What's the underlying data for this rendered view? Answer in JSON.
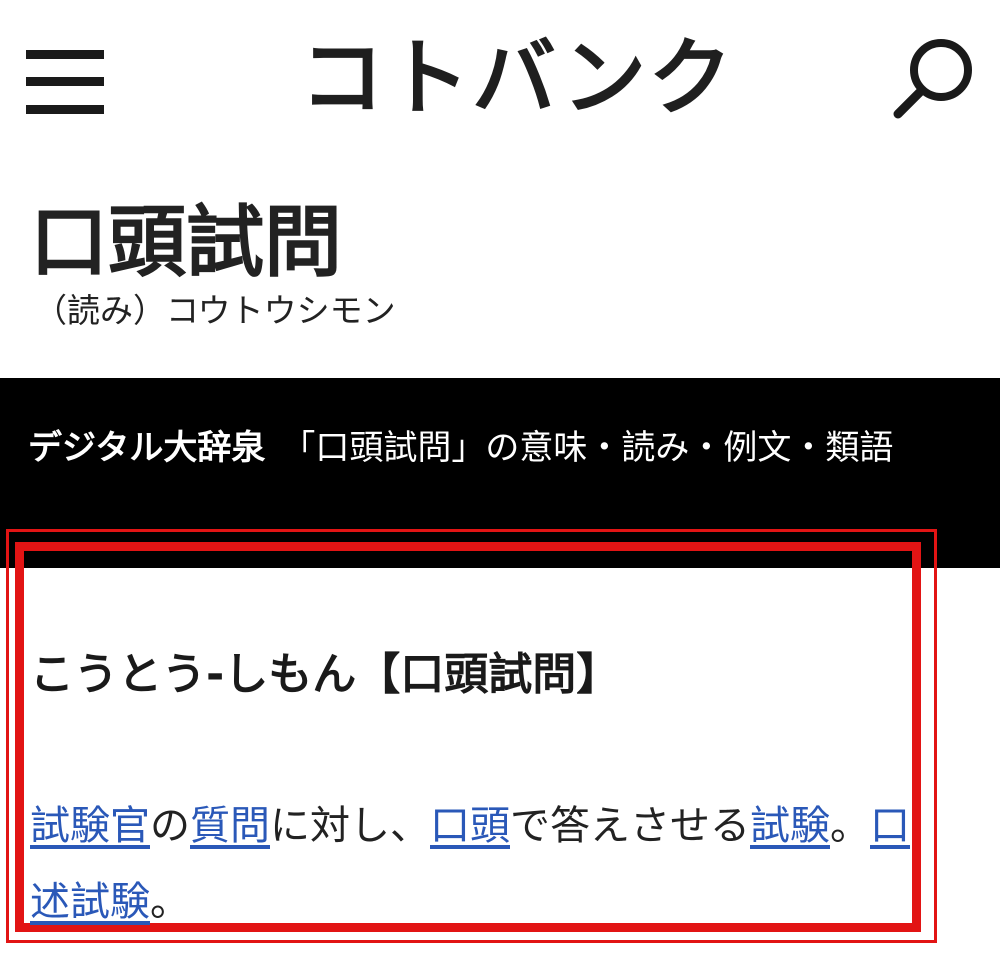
{
  "header": {
    "brand": "コトバンク",
    "menu_icon": "hamburger-menu-icon",
    "search_icon": "magnifier-search-icon"
  },
  "entry": {
    "title": "口頭試問",
    "reading": "（読み）コウトウシモン"
  },
  "dictionary": {
    "name": "デジタル大辞泉",
    "description": "「口頭試問」の意味・読み・例文・類語"
  },
  "definition_block": {
    "heading": "こうとう-しもん【口頭試問】",
    "segments": [
      {
        "text": "試験官",
        "link": true
      },
      {
        "text": "の",
        "link": false
      },
      {
        "text": "質問",
        "link": true
      },
      {
        "text": "に対し、",
        "link": false
      },
      {
        "text": "口頭",
        "link": true
      },
      {
        "text": "で答えさせる",
        "link": false
      },
      {
        "text": "試験",
        "link": true
      },
      {
        "text": "。",
        "link": false
      },
      {
        "text": "口述試験",
        "link": true
      },
      {
        "text": "。",
        "link": false
      }
    ],
    "link_color": "#2a58b8",
    "highlight_color": "#e21414"
  }
}
